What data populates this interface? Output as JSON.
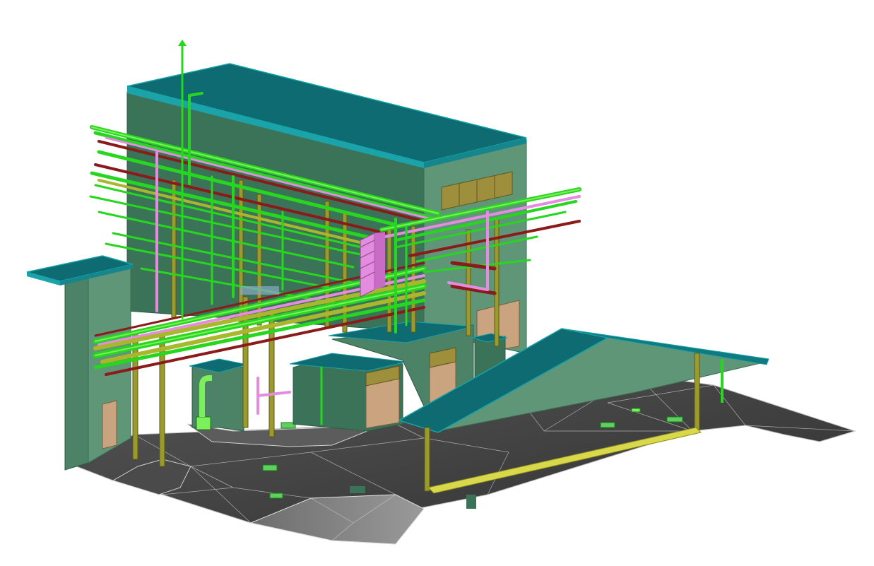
{
  "scene": {
    "subject": "isometric-plant-building-with-pipe-rack",
    "colors": {
      "background": "#ffffff",
      "roof": "#0e6b72",
      "roof_edge": "#17a2a8",
      "wall_light": "#5f9677",
      "wall_dark": "#3b7358",
      "wall_mid": "#4c8266",
      "ground": "#3d3d3d",
      "ground_light": "#6a6a6a",
      "ground_lines": "#cfcfcf",
      "pipe_green": "#27d61e",
      "pipe_green_light": "#7cf05a",
      "pipe_olive": "#a9b72c",
      "pipe_red": "#8b1b1b",
      "pipe_pink": "#e38ce0",
      "column": "#9a9a2e",
      "door": "#c9a47f",
      "louver": "#9d8f3c",
      "walkway": "#d8d84a"
    }
  }
}
